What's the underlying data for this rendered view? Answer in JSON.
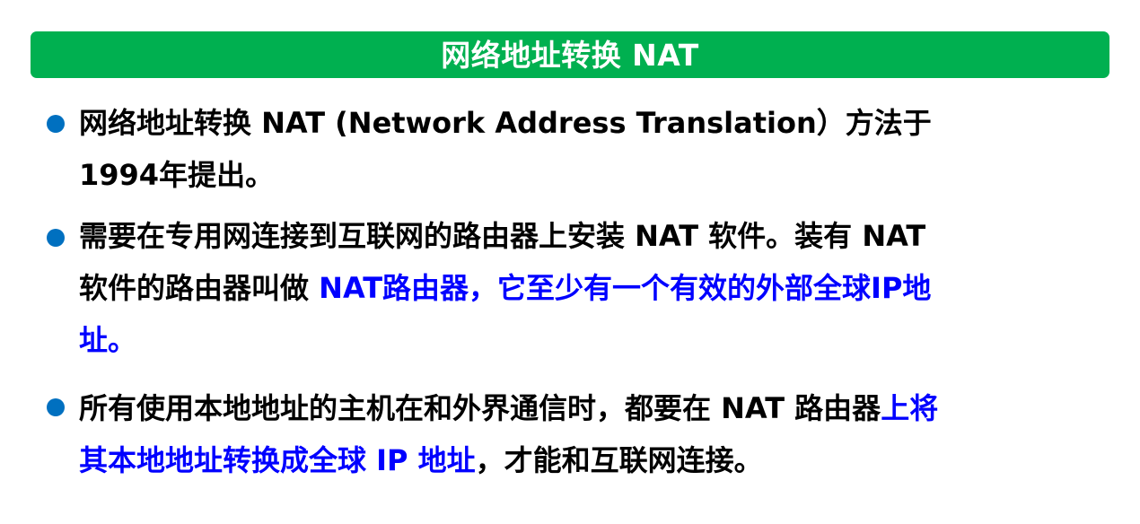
{
  "title": "网络地址转换 NAT",
  "bullets": [
    {
      "line1": "网络地址转换 NAT (Network Address Translation）方法于",
      "line2": "1994年提出。"
    },
    {
      "line1": "需要在专用网连接到互联网的路由器上安装 NAT 软件。装有 NAT",
      "line2_prefix": "软件的路由器叫做 ",
      "highlight_a": "NAT路由器，它至少有一个有效的外部全球IP地",
      "highlight_b": "址。"
    },
    {
      "line1_prefix": "所有使用本地地址的主机在和外界通信时，都要在 NAT 路由器",
      "highlight_a": "上将",
      "highlight_b": "其本地地址转换成全球 IP 地址",
      "suffix": "，才能和互联网连接。"
    }
  ],
  "colors": {
    "title_bar": "#00b050",
    "bullet_dot": "#0070c0",
    "highlight": "#0000ff"
  }
}
